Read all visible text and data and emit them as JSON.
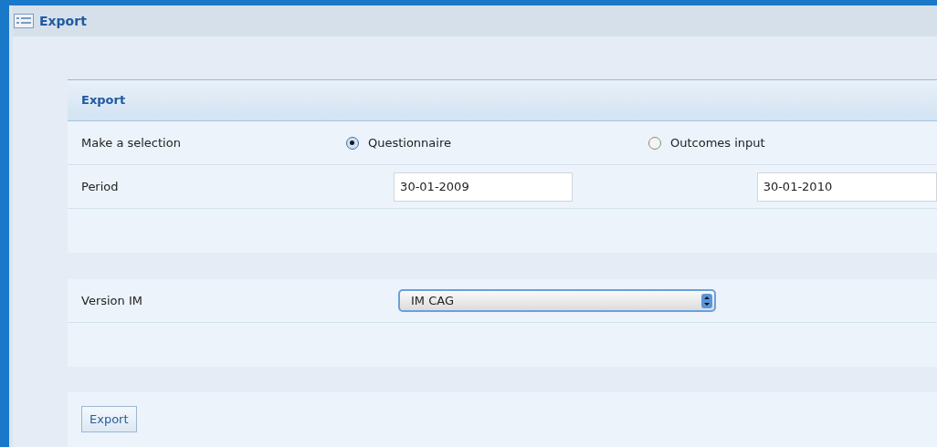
{
  "window": {
    "title": "Export"
  },
  "panel": {
    "title": "Export",
    "selection": {
      "label": "Make a selection",
      "options": [
        {
          "label": "Questionnaire",
          "selected": true
        },
        {
          "label": "Outcomes input",
          "selected": false
        }
      ]
    },
    "period": {
      "label": "Period",
      "from": "30-01-2009",
      "to": "30-01-2010"
    },
    "version": {
      "label": "Version IM",
      "value": "IM CAG"
    },
    "buttons": [
      "Export"
    ]
  }
}
